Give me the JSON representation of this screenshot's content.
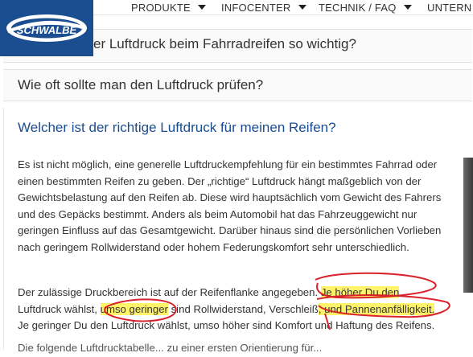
{
  "brand": {
    "logo_text": "SCHWALBE"
  },
  "nav": [
    {
      "label": "PRODUKTE"
    },
    {
      "label": "INFOCENTER"
    },
    {
      "label": "TECHNIK / FAQ"
    },
    {
      "label": "UNTERN"
    }
  ],
  "accordion": {
    "q1": "er Luftdruck beim Fahrradreifen so wichtig?",
    "q2": "Wie oft sollte man den Luftdruck prüfen?",
    "q3_active": "Welcher ist der richtige Luftdruck für meinen Reifen?"
  },
  "answer": {
    "p1": "Es ist nicht möglich, eine generelle Luftdruckempfehlung für ein bestimmtes Fahrrad oder einen bestimmten Reifen zu geben. Der „richtige“ Luftdruck hängt maßgeblich von der Gewichtsbelastung auf den Reifen ab. Diese wird hauptsächlich vom Gewicht des Fahrers und des Gepäcks bestimmt. Anders als beim Automobil hat das Fahrzeuggewicht nur geringen Einfluss auf das Gesamtgewicht. Darüber hinaus sind die persönlichen Vorlieben nach geringem Rollwiderstand oder hohem Federungskomfort sehr unterschiedlich.",
    "p2_a": "Der zulässige Druckbereich ist auf der Reifenflanke angegeben.",
    "p2_hl1": "Je höher Du den",
    "p2_b": "Luftdruck wählst, ",
    "p2_hl2": "umso geringer",
    "p2_c": " sind Rollwiderstand, Verschleiß",
    "p2_hl3": ", und Pannenanfälligkeit.",
    "p2_d": "Je geringer Du den Luftdruck wählst, umso höher sind Komfort und Haftung des Reifens.",
    "cut_line": "Die folgende Luftdrucktabelle... zu einer ersten Orientierung für..."
  },
  "colors": {
    "brand_blue": "#1b4d91",
    "highlight": "#fff36a",
    "pen_red": "#d8232a"
  }
}
